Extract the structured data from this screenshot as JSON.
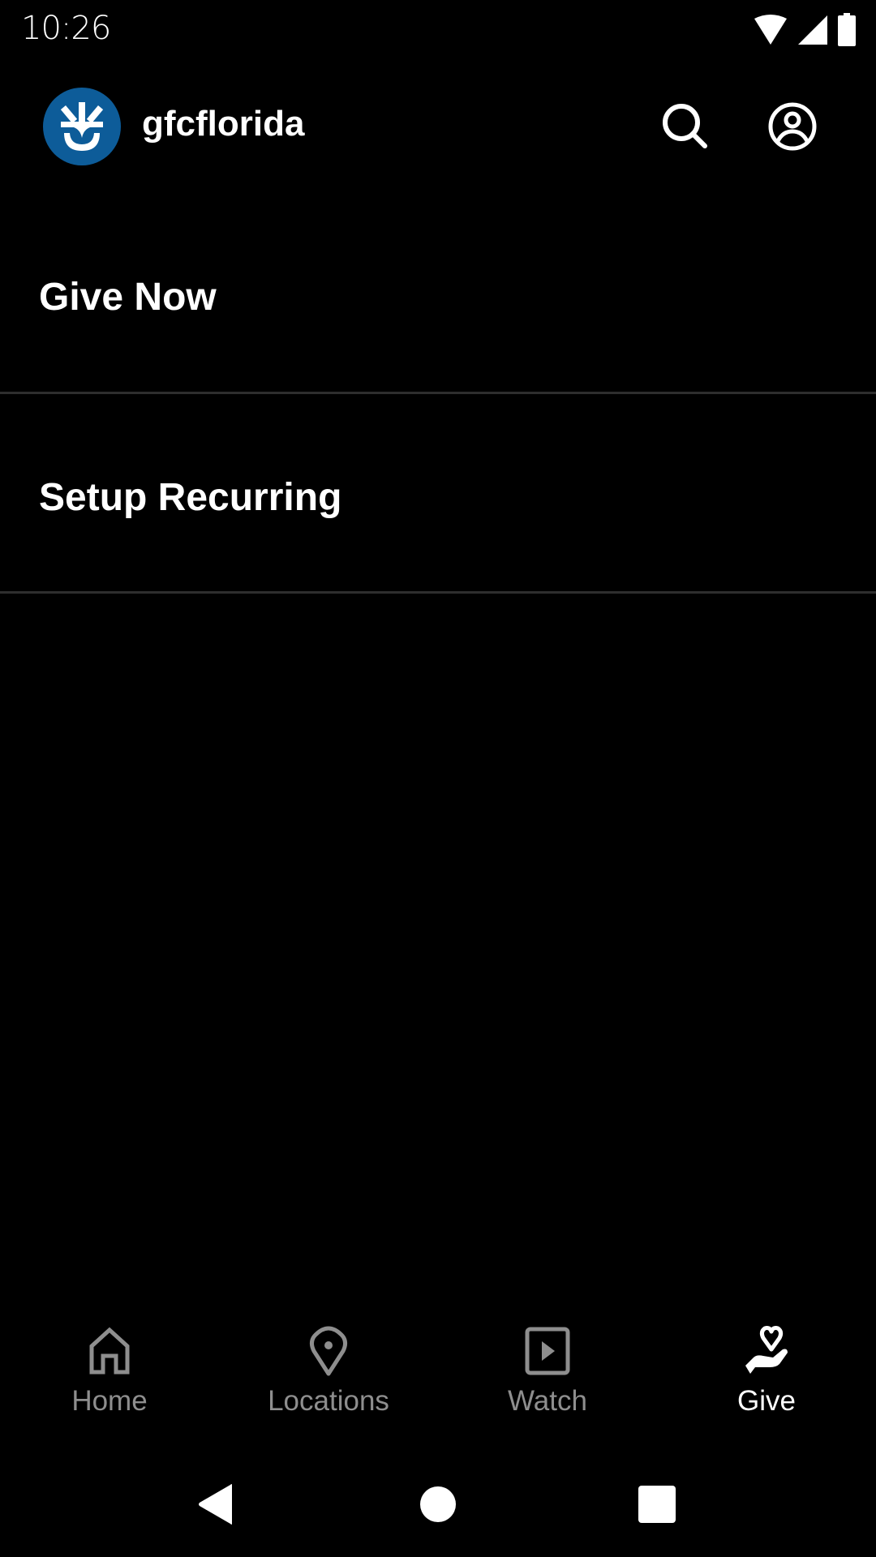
{
  "status_bar": {
    "time": "10:26",
    "icons": [
      "wifi-icon",
      "signal-icon",
      "battery-icon"
    ]
  },
  "header": {
    "logo": "gfc-logo",
    "brand_color": "#0d5c99",
    "title": "gfcflorida",
    "actions": [
      "search-icon",
      "account-icon"
    ]
  },
  "menu": {
    "items": [
      {
        "label": "Give Now"
      },
      {
        "label": "Setup Recurring"
      }
    ]
  },
  "bottom_nav": {
    "active_index": 3,
    "tabs": [
      {
        "label": "Home",
        "icon": "home-icon"
      },
      {
        "label": "Locations",
        "icon": "location-pin-icon"
      },
      {
        "label": "Watch",
        "icon": "play-icon"
      },
      {
        "label": "Give",
        "icon": "give-hand-heart-icon"
      }
    ],
    "inactive_color": "#8e8e8e",
    "active_color": "#ffffff"
  },
  "system_nav": {
    "buttons": [
      "back-icon",
      "home-circle-icon",
      "recents-icon"
    ]
  }
}
